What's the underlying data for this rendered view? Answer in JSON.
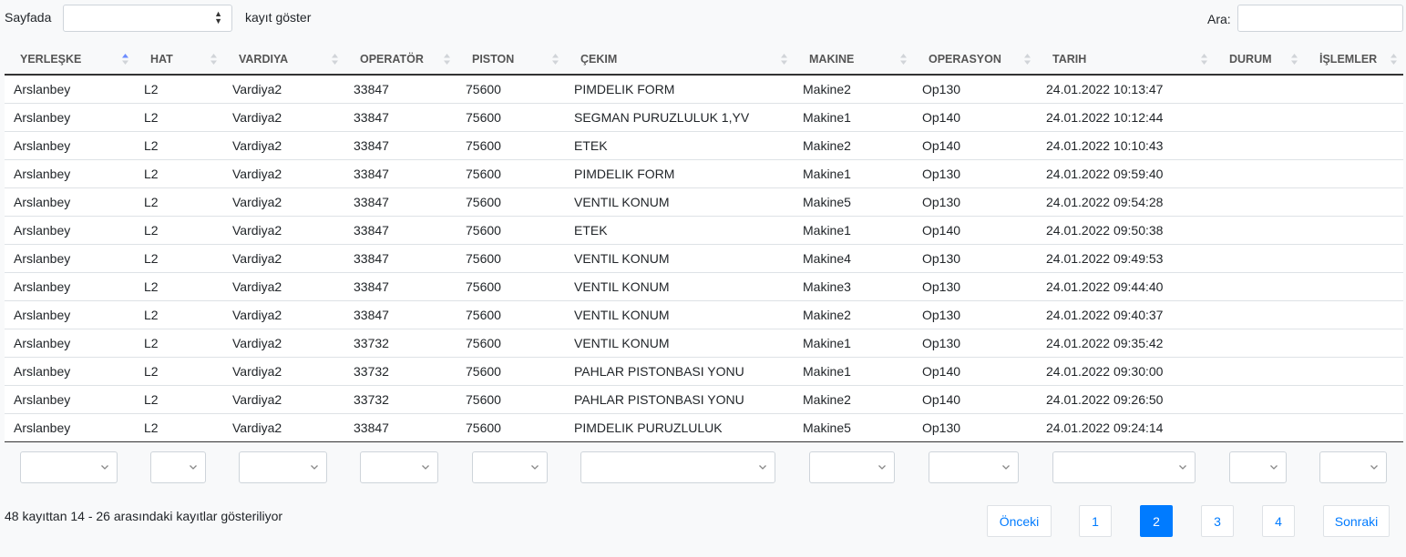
{
  "length_menu": {
    "prefix": "Sayfada",
    "suffix": "kayıt göster",
    "selected": ""
  },
  "search": {
    "label": "Ara:",
    "value": ""
  },
  "columns": [
    "YERLEŞKE",
    "HAT",
    "VARDIYA",
    "OPERATÖR",
    "PISTON",
    "ÇEKIM",
    "MAKINE",
    "OPERASYON",
    "TARIH",
    "DURUM",
    "İŞLEMLER"
  ],
  "sorted_column": "YERLEŞKE",
  "rows": [
    [
      "Arslanbey",
      "L2",
      "Vardiya2",
      "33847",
      "75600",
      "PIMDELIK FORM",
      "Makine2",
      "Op130",
      "24.01.2022 10:13:47",
      "",
      ""
    ],
    [
      "Arslanbey",
      "L2",
      "Vardiya2",
      "33847",
      "75600",
      "SEGMAN PURUZLULUK 1,YV",
      "Makine1",
      "Op140",
      "24.01.2022 10:12:44",
      "",
      ""
    ],
    [
      "Arslanbey",
      "L2",
      "Vardiya2",
      "33847",
      "75600",
      "ETEK",
      "Makine2",
      "Op140",
      "24.01.2022 10:10:43",
      "",
      ""
    ],
    [
      "Arslanbey",
      "L2",
      "Vardiya2",
      "33847",
      "75600",
      "PIMDELIK FORM",
      "Makine1",
      "Op130",
      "24.01.2022 09:59:40",
      "",
      ""
    ],
    [
      "Arslanbey",
      "L2",
      "Vardiya2",
      "33847",
      "75600",
      "VENTIL KONUM",
      "Makine5",
      "Op130",
      "24.01.2022 09:54:28",
      "",
      ""
    ],
    [
      "Arslanbey",
      "L2",
      "Vardiya2",
      "33847",
      "75600",
      "ETEK",
      "Makine1",
      "Op140",
      "24.01.2022 09:50:38",
      "",
      ""
    ],
    [
      "Arslanbey",
      "L2",
      "Vardiya2",
      "33847",
      "75600",
      "VENTIL KONUM",
      "Makine4",
      "Op130",
      "24.01.2022 09:49:53",
      "",
      ""
    ],
    [
      "Arslanbey",
      "L2",
      "Vardiya2",
      "33847",
      "75600",
      "VENTIL KONUM",
      "Makine3",
      "Op130",
      "24.01.2022 09:44:40",
      "",
      ""
    ],
    [
      "Arslanbey",
      "L2",
      "Vardiya2",
      "33847",
      "75600",
      "VENTIL KONUM",
      "Makine2",
      "Op130",
      "24.01.2022 09:40:37",
      "",
      ""
    ],
    [
      "Arslanbey",
      "L2",
      "Vardiya2",
      "33732",
      "75600",
      "VENTIL KONUM",
      "Makine1",
      "Op130",
      "24.01.2022 09:35:42",
      "",
      ""
    ],
    [
      "Arslanbey",
      "L2",
      "Vardiya2",
      "33732",
      "75600",
      "PAHLAR PISTONBASI YONU",
      "Makine1",
      "Op140",
      "24.01.2022 09:30:00",
      "",
      ""
    ],
    [
      "Arslanbey",
      "L2",
      "Vardiya2",
      "33732",
      "75600",
      "PAHLAR PISTONBASI YONU",
      "Makine2",
      "Op140",
      "24.01.2022 09:26:50",
      "",
      ""
    ],
    [
      "Arslanbey",
      "L2",
      "Vardiya2",
      "33847",
      "75600",
      "PIMDELIK PURUZLULUK",
      "Makine5",
      "Op130",
      "24.01.2022 09:24:14",
      "",
      ""
    ]
  ],
  "info": "48 kayıttan 14 - 26 arasındaki kayıtlar gösteriliyor",
  "pagination": {
    "previous": "Önceki",
    "next": "Sonraki",
    "pages": [
      "1",
      "2",
      "3",
      "4"
    ],
    "active_page": "2"
  },
  "colors": {
    "accent": "#007bff",
    "sort_active": "#6c8cff",
    "sort_idle": "#d0d4d8"
  }
}
